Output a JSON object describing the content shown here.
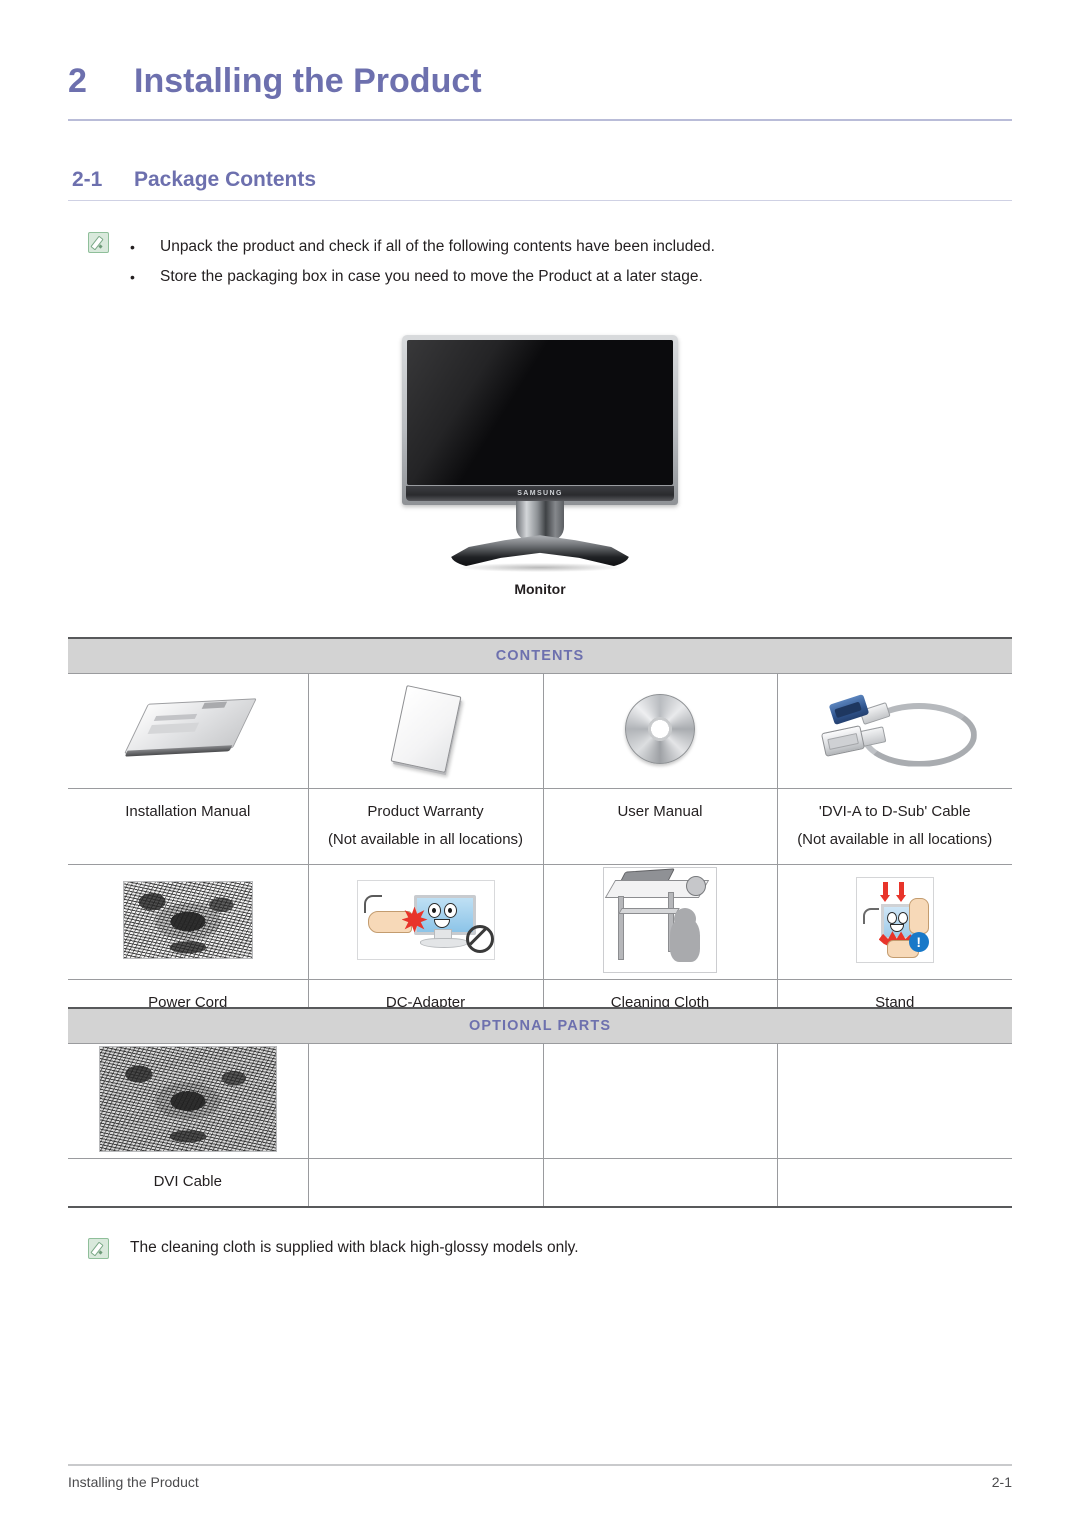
{
  "chapter": {
    "number": "2",
    "title": "Installing the Product"
  },
  "section": {
    "number": "2-1",
    "title": "Package Contents"
  },
  "intro": {
    "bullet_marker": "•",
    "items": [
      "Unpack the product and check if all of the following contents have been included.",
      "Store the packaging box in case you need to move the Product at a later stage."
    ]
  },
  "figure": {
    "caption": "Monitor",
    "brand_logo": "SAMSUNG"
  },
  "contents_table": {
    "header": "CONTENTS",
    "rows": [
      [
        {
          "label": "Installation Manual",
          "sublabel": "",
          "art": "booklet"
        },
        {
          "label": "Product Warranty",
          "sublabel": "(Not available in all locations)",
          "art": "card"
        },
        {
          "label": "User Manual",
          "sublabel": "",
          "art": "cd"
        },
        {
          "label": "'DVI-A to D-Sub' Cable",
          "sublabel": "(Not available in all locations)",
          "art": "cable"
        }
      ],
      [
        {
          "label": "Power Cord",
          "sublabel": "",
          "art": "noise"
        },
        {
          "label": "DC-Adapter",
          "sublabel": "",
          "art": "warn-touch-screen"
        },
        {
          "label": "Cleaning Cloth",
          "sublabel": "",
          "art": "warn-desk-child"
        },
        {
          "label": "Stand",
          "sublabel": "",
          "art": "warn-press-screen"
        }
      ]
    ]
  },
  "optional_table": {
    "header": "OPTIONAL PARTS",
    "rows": [
      [
        {
          "label": "DVI Cable",
          "sublabel": "",
          "art": "noise-wide"
        },
        {
          "label": "",
          "sublabel": "",
          "art": ""
        },
        {
          "label": "",
          "sublabel": "",
          "art": ""
        },
        {
          "label": "",
          "sublabel": "",
          "art": ""
        }
      ]
    ]
  },
  "bottom_note": {
    "text": "The cleaning cloth is supplied with black high-glossy models only."
  },
  "footer": {
    "left": "Installing the Product",
    "right": "2-1"
  },
  "colors": {
    "heading": "#6d70ae",
    "band_bg": "#d3d3d3",
    "band_text": "#6d70ae",
    "body_text": "#231f20",
    "rule": "#9a9b9e",
    "note_icon_border": "#8fbf9a",
    "note_icon_bg": "#d9e9dc",
    "accent_red": "#e8342a",
    "accent_blue": "#1878c8"
  }
}
